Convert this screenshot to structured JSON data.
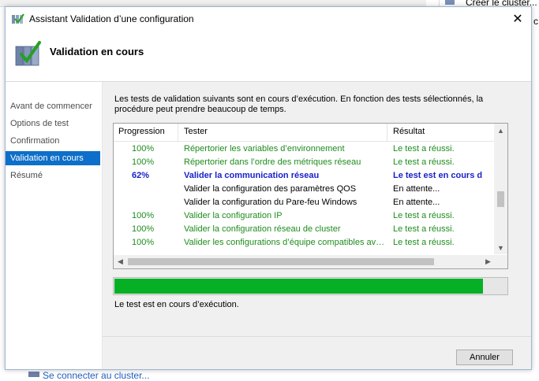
{
  "background": {
    "create_cluster_label": "Créer le cluster...",
    "side_label": "c",
    "bottom_link": "Se connecter au cluster..."
  },
  "dialog": {
    "title": "Assistant Validation d’une configuration",
    "header_title": "Validation en cours",
    "close_glyph": "✕"
  },
  "sidebar": {
    "items": [
      {
        "label": "Avant de commencer"
      },
      {
        "label": "Options de test"
      },
      {
        "label": "Confirmation"
      },
      {
        "label": "Validation en cours"
      },
      {
        "label": "Résumé"
      }
    ],
    "active_index": 3
  },
  "content": {
    "description": "Les tests de validation suivants sont en cours d’exécution. En fonction des tests sélectionnés, la procédure peut prendre beaucoup de temps.",
    "columns": {
      "progress": "Progression",
      "tester": "Tester",
      "result": "Résultat"
    },
    "rows": [
      {
        "progress": "100%",
        "tester": "Répertorier les variables d’environnement",
        "result": "Le test a réussi.",
        "state": "green"
      },
      {
        "progress": "100%",
        "tester": "Répertorier dans l’ordre des métriques réseau",
        "result": "Le test a réussi.",
        "state": "green"
      },
      {
        "progress": "62%",
        "tester": "Valider la communication réseau",
        "result": "Le test est en cours d",
        "state": "active"
      },
      {
        "progress": "",
        "tester": "Valider la configuration des paramètres QOS",
        "result": "En attente...",
        "state": "pending"
      },
      {
        "progress": "",
        "tester": "Valider la configuration du Pare-feu Windows",
        "result": "En attente...",
        "state": "pending"
      },
      {
        "progress": "100%",
        "tester": "Valider la configuration IP",
        "result": "Le test a réussi.",
        "state": "green"
      },
      {
        "progress": "100%",
        "tester": "Valider la configuration réseau de cluster",
        "result": "Le test a réussi.",
        "state": "green"
      },
      {
        "progress": "100%",
        "tester": "Valider les configurations d’équipe compatibles ave...",
        "result": "Le test a réussi.",
        "state": "green"
      }
    ],
    "overall_progress_fraction": 0.94,
    "status_text": "Le test est en cours d’exécution.",
    "cancel_label": "Annuler"
  },
  "colors": {
    "accent": "#0d6fc9",
    "success_text": "#1e8c1e",
    "active_text": "#1a21c9",
    "progress_fill": "#06b025"
  },
  "icons": {
    "title": "cluster-validation-icon",
    "header": "cluster-validation-check-icon"
  }
}
